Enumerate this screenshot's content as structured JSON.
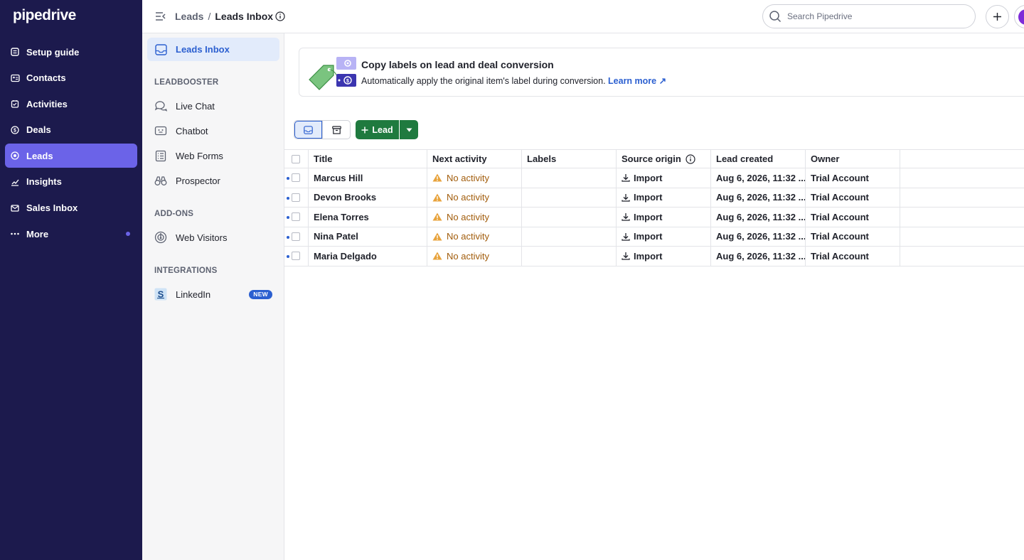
{
  "app": {
    "logo": "pipedrive"
  },
  "nav": {
    "items": [
      {
        "label": "Setup guide",
        "icon": "setup-icon"
      },
      {
        "label": "Contacts",
        "icon": "contacts-icon"
      },
      {
        "label": "Activities",
        "icon": "activities-icon"
      },
      {
        "label": "Deals",
        "icon": "deals-icon"
      },
      {
        "label": "Leads",
        "icon": "leads-icon",
        "active": true
      },
      {
        "label": "Insights",
        "icon": "insights-icon"
      },
      {
        "label": "Sales Inbox",
        "icon": "sales-inbox-icon"
      },
      {
        "label": "More",
        "icon": "more-icon"
      }
    ]
  },
  "subnav": {
    "active": "Leads Inbox",
    "sections": [
      {
        "title": "LEADBOOSTER",
        "items": [
          "Live Chat",
          "Chatbot",
          "Web Forms",
          "Prospector"
        ]
      },
      {
        "title": "ADD-ONS",
        "items": [
          "Web Visitors"
        ]
      },
      {
        "title": "INTEGRATIONS",
        "items": [
          "LinkedIn"
        ]
      }
    ],
    "new_badge": "NEW"
  },
  "topbar": {
    "breadcrumb_parent": "Leads",
    "breadcrumb_sep": "/",
    "breadcrumb_current": "Leads Inbox",
    "search_placeholder": "Search Pipedrive"
  },
  "banner": {
    "title": "Copy labels on lead and deal conversion",
    "text": "Automatically apply the original item's label during conversion.",
    "link": "Learn more ↗"
  },
  "toolbar": {
    "lead_button": "Lead"
  },
  "table": {
    "headers": [
      "Title",
      "Next activity",
      "Labels",
      "Source origin",
      "Lead created",
      "Owner"
    ],
    "rows": [
      {
        "title": "Marcus Hill",
        "next": "No activity",
        "labels": "",
        "source": "Import",
        "created": "Aug 6, 2026, 11:32 ...",
        "owner": "Trial Account"
      },
      {
        "title": "Devon Brooks",
        "next": "No activity",
        "labels": "",
        "source": "Import",
        "created": "Aug 6, 2026, 11:32 ...",
        "owner": "Trial Account"
      },
      {
        "title": "Elena Torres",
        "next": "No activity",
        "labels": "",
        "source": "Import",
        "created": "Aug 6, 2026, 11:32 ...",
        "owner": "Trial Account"
      },
      {
        "title": "Nina Patel",
        "next": "No activity",
        "labels": "",
        "source": "Import",
        "created": "Aug 6, 2026, 11:32 ...",
        "owner": "Trial Account"
      },
      {
        "title": "Maria Delgado",
        "next": "No activity",
        "labels": "",
        "source": "Import",
        "created": "Aug 6, 2026, 11:32 ...",
        "owner": "Trial Account"
      }
    ]
  },
  "colors": {
    "nav_bg": "#1c1a4d",
    "nav_active": "#6b63e8",
    "primary_blue": "#2b5fd0",
    "lead_green": "#1f7a3f",
    "warning": "#a15c0b"
  }
}
